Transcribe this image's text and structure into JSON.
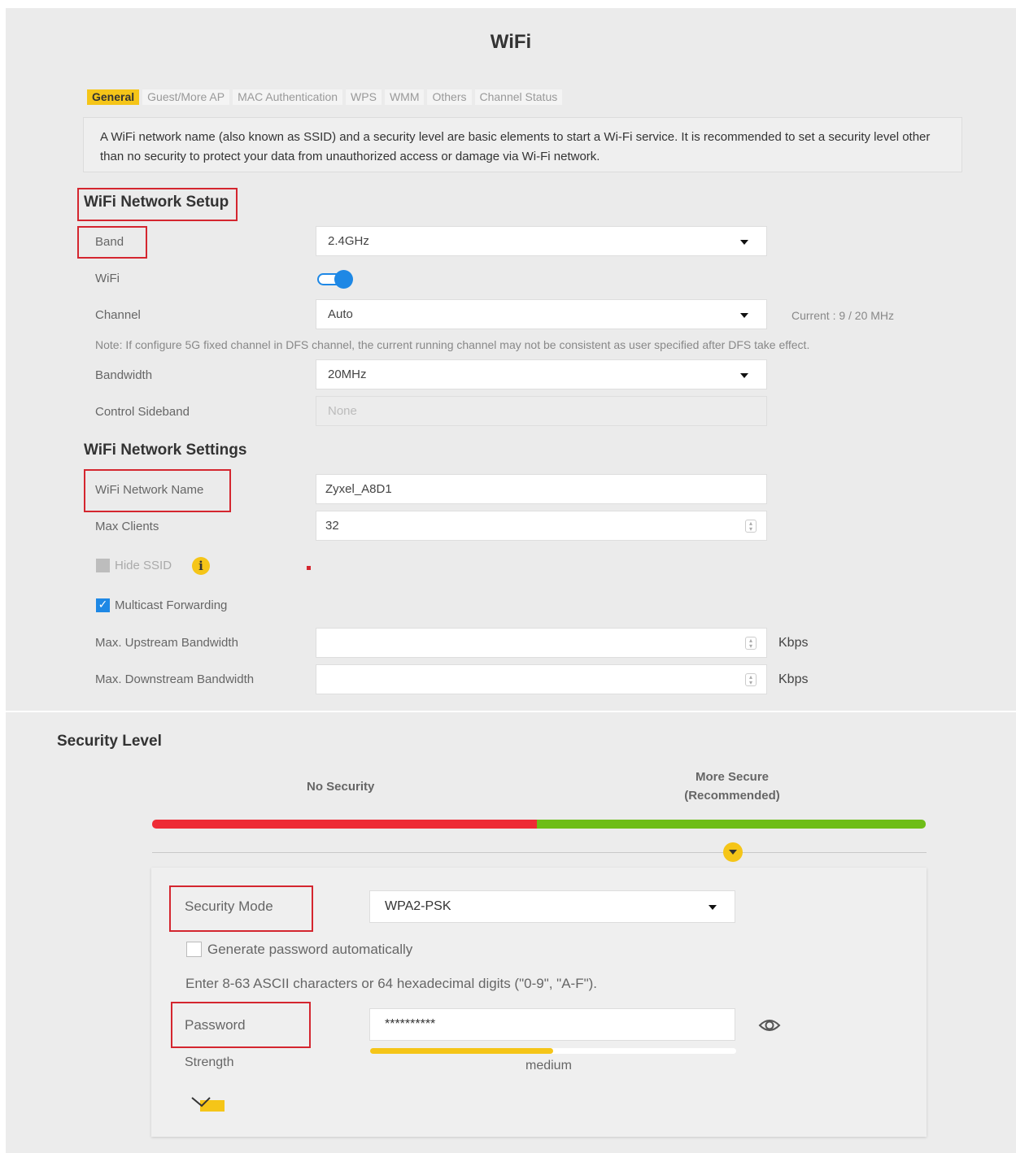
{
  "page_title": "WiFi",
  "tabs": [
    "General",
    "Guest/More AP",
    "MAC Authentication",
    "WPS",
    "WMM",
    "Others",
    "Channel Status"
  ],
  "info_text": "A WiFi network name (also known as SSID) and a security level are basic elements to start a Wi-Fi service. It is recommended to set a security level other than no security to protect your data from unauthorized access or damage via Wi-Fi network.",
  "setup": {
    "title": "WiFi Network Setup",
    "band_label": "Band",
    "band_value": "2.4GHz",
    "wifi_label": "WiFi",
    "wifi_enabled": true,
    "channel_label": "Channel",
    "channel_value": "Auto",
    "channel_current": "Current : 9 / 20 MHz",
    "note": "Note: If configure 5G fixed channel in DFS channel, the current running channel may not be consistent as user specified after DFS take effect.",
    "bandwidth_label": "Bandwidth",
    "bandwidth_value": "20MHz",
    "sideband_label": "Control Sideband",
    "sideband_value": "None"
  },
  "settings": {
    "title": "WiFi Network Settings",
    "name_label": "WiFi Network Name",
    "name_value": "Zyxel_A8D1",
    "max_clients_label": "Max Clients",
    "max_clients_value": "32",
    "hide_ssid_label": "Hide SSID",
    "hide_ssid_checked": false,
    "multicast_label": "Multicast Forwarding",
    "multicast_checked": true,
    "upstream_label": "Max. Upstream Bandwidth",
    "downstream_label": "Max. Downstream Bandwidth",
    "unit": "Kbps"
  },
  "security": {
    "title": "Security Level",
    "no_security": "No Security",
    "more_secure_line1": "More Secure",
    "more_secure_line2": "(Recommended)",
    "mode_label": "Security Mode",
    "mode_value": "WPA2-PSK",
    "generate_label": "Generate password automatically",
    "generate_checked": false,
    "hint": "Enter 8-63 ASCII characters or 64 hexadecimal digits (\"0-9\", \"A-F\").",
    "password_label": "Password",
    "password_value": "**********",
    "strength_label": "Strength",
    "strength_text": "medium",
    "strength_fraction": 0.5
  },
  "colors": {
    "accent_yellow": "#f5c518",
    "toggle_blue": "#1e88e5",
    "highlight_red": "#d4262f",
    "bar_red": "#ee2b35",
    "bar_green": "#6ebd18"
  }
}
